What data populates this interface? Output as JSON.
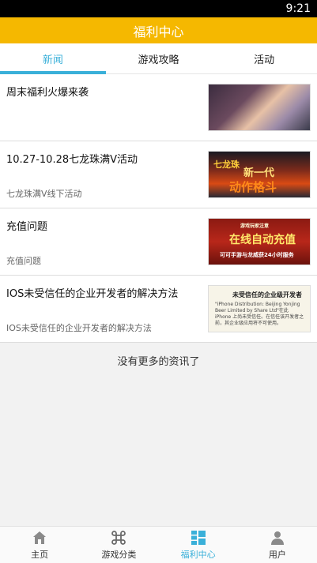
{
  "status_bar": {
    "time": "9:21"
  },
  "app_bar": {
    "title": "福利中心"
  },
  "tabs": [
    {
      "label": "新闻"
    },
    {
      "label": "游戏攻略"
    },
    {
      "label": "活动"
    }
  ],
  "news": [
    {
      "title": "周末福利火爆来袭",
      "subtitle": ""
    },
    {
      "title": "10.27-10.28七龙珠满V活动",
      "subtitle": "七龙珠满V线下活动",
      "image_text": [
        "七龙珠",
        "新一代",
        "动作格斗"
      ]
    },
    {
      "title": "充值问题",
      "subtitle": "充值问题",
      "image_text": [
        "游戏玩家注意",
        "在线自动充值",
        "可可手游与龙威获24小时服务"
      ]
    },
    {
      "title": "IOS未受信任的企业开发者的解决方法",
      "subtitle": "IOS未受信任的企业开发者的解决方法",
      "image_text": [
        "未受信任的企业级开发者",
        "\"iPhone Distribution: Beijing Yonjing Beer Limited by Share Ltd\"在此 iPhone 上尚未受信任。在信任该开发者之前，其企业级应用将不可使用。"
      ]
    }
  ],
  "more_text": "没有更多的资讯了",
  "bottom_nav": [
    {
      "label": "主页",
      "icon": "home-icon"
    },
    {
      "label": "游戏分类",
      "icon": "command-icon"
    },
    {
      "label": "福利中心",
      "icon": "grid-list-icon"
    },
    {
      "label": "用户",
      "icon": "user-icon"
    }
  ],
  "colors": {
    "accent": "#3ab0d9",
    "app_bar": "#f5b800"
  }
}
